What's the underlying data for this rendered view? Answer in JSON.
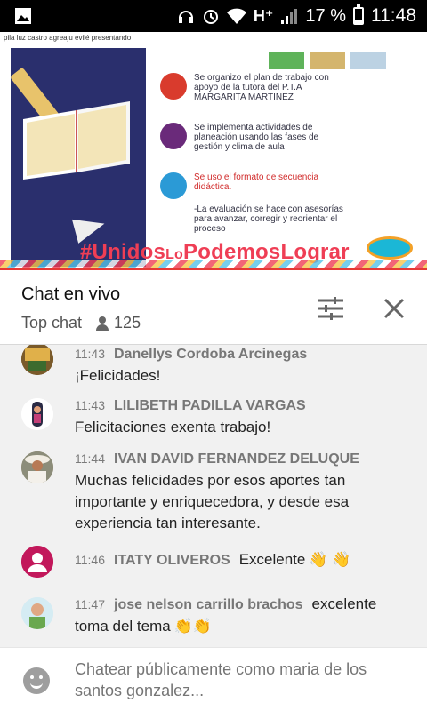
{
  "status_bar": {
    "network": "H⁺",
    "battery_percent": "17 %",
    "battery_level": 0.17,
    "time": "11:48"
  },
  "video": {
    "presenter_text": "pila luz castro agreaju evilé presentando",
    "slide_points": [
      "Se organizo el plan de trabajo con apoyo de la tutora del P.T.A MARGARITA MARTINEZ",
      "Se implementa actividades de planeación usando las fases de gestión y clima de aula",
      "Se uso el formato de secuencia didáctica.",
      "-La evaluación se hace con asesorías para avanzar, corregir y reorientar el proceso"
    ],
    "hashtag_part1": "#Unidos",
    "hashtag_part2": "Lo",
    "hashtag_part3": "Podemos",
    "hashtag_part4": "Lograr",
    "progress": 1.0
  },
  "chat_header": {
    "title": "Chat en vivo",
    "mode": "Top chat",
    "viewer_count": "125"
  },
  "messages": [
    {
      "time": "11:43",
      "author": "Danellys Cordoba Arcinegas",
      "text": "¡Felicidades!",
      "emoji": ""
    },
    {
      "time": "11:43",
      "author": "LILIBETH PADILLA VARGAS",
      "text": "Felicitaciones exenta trabajo!",
      "emoji": ""
    },
    {
      "time": "11:44",
      "author": "IVAN DAVID FERNANDEZ DELUQUE",
      "text": "Muchas felicidades por esos aportes tan importante y enriquecedora, y desde esa experiencia tan interesante.",
      "emoji": ""
    },
    {
      "time": "11:46",
      "author": "ITATY OLIVEROS",
      "text": "Excelente",
      "emoji": "👋 👋"
    },
    {
      "time": "11:47",
      "author": "jose nelson carrillo brachos",
      "text": "excelente toma del tema",
      "emoji": "👏👏"
    }
  ],
  "input": {
    "placeholder": "Chatear públicamente como maria de los santos gonzalez..."
  },
  "colors": {
    "accent": "#e53935",
    "hashtag": "#ef3e55",
    "avatar_pink": "#c2185b"
  }
}
